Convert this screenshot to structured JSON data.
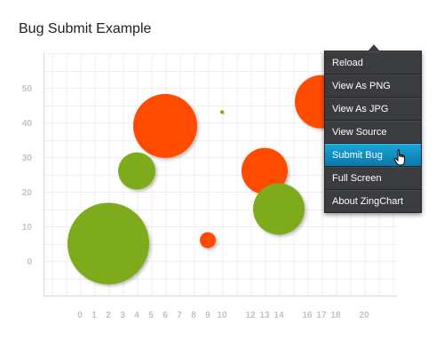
{
  "title": "Bug Submit Example",
  "chart_data": {
    "type": "bubble",
    "title": "Bug Submit Example",
    "xlabel": "",
    "ylabel": "",
    "x_ticks": [
      0,
      1,
      2,
      3,
      4,
      5,
      6,
      7,
      8,
      9,
      10,
      12,
      13,
      14,
      16,
      17,
      18,
      20
    ],
    "y_ticks": [
      0,
      10,
      20,
      30,
      40,
      50
    ],
    "ylim": [
      -10,
      60
    ],
    "grid": true,
    "series": [
      {
        "color": "#ff4c00",
        "points": [
          {
            "x": 6,
            "y": 39,
            "size": 36
          },
          {
            "x": 9,
            "y": 6,
            "size": 9
          },
          {
            "x": 13,
            "y": 26,
            "size": 26
          },
          {
            "x": 17,
            "y": 46,
            "size": 30
          }
        ]
      },
      {
        "color": "#7dab1a",
        "points": [
          {
            "x": 2,
            "y": 5,
            "size": 46
          },
          {
            "x": 4,
            "y": 26,
            "size": 21
          },
          {
            "x": 10,
            "y": 43,
            "size": 2
          },
          {
            "x": 14,
            "y": 15,
            "size": 29
          }
        ]
      }
    ]
  },
  "context_menu": {
    "items": [
      {
        "label": "Reload"
      },
      {
        "label": "View As PNG"
      },
      {
        "label": "View As JPG"
      },
      {
        "label": "View Source"
      },
      {
        "label": "Submit Bug",
        "active": true
      },
      {
        "label": "Full Screen"
      },
      {
        "label": "About ZingChart"
      }
    ]
  },
  "colors": {
    "menu_background": "#3a3c3f",
    "menu_active": "#0a8fc4",
    "axis": "#d8d8d8",
    "grid": "#eeeeee",
    "tick_label": "#c2c2c2"
  },
  "cursor": {
    "icon": "hand-pointer-icon"
  }
}
